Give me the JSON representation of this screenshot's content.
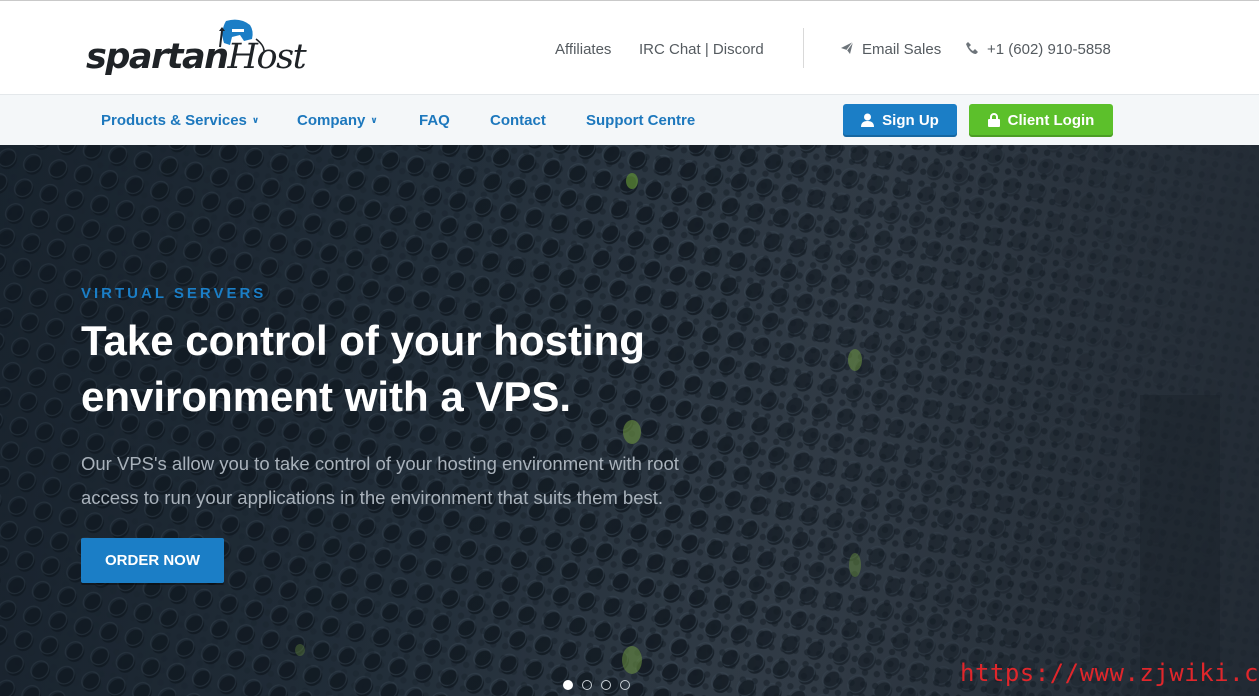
{
  "brand": {
    "logo_text_main": "spartan",
    "logo_text_sub": "Host"
  },
  "top_links": [
    {
      "label": "Affiliates"
    },
    {
      "label": "IRC Chat | Discord"
    }
  ],
  "contact": {
    "email_label": "Email Sales",
    "phone_label": "+1 (602) 910-5858"
  },
  "nav": {
    "items": [
      {
        "label": "Products & Services",
        "has_dropdown": true
      },
      {
        "label": "Company",
        "has_dropdown": true
      },
      {
        "label": "FAQ",
        "has_dropdown": false
      },
      {
        "label": "Contact",
        "has_dropdown": false
      },
      {
        "label": "Support Centre",
        "has_dropdown": false
      }
    ],
    "signup_label": "Sign Up",
    "login_label": "Client Login"
  },
  "hero": {
    "eyebrow": "VIRTUAL SERVERS",
    "headline_line1": "Take control of your hosting",
    "headline_line2": "environment with a VPS.",
    "subtext_line1": "Our VPS's allow you to take control of your hosting environment with root",
    "subtext_line2": "access to run your applications in the environment that suits them best.",
    "cta_label": "ORDER NOW",
    "slides_total": 4,
    "active_slide": 1
  },
  "watermark": "https://www.zjwiki.com",
  "colors": {
    "primary_blue": "#1b7ec6",
    "login_green": "#5cc02b",
    "nav_bg": "#f4f7f9",
    "hero_dark": "#2b3844"
  },
  "icons": [
    "paper-plane-icon",
    "phone-icon",
    "user-icon",
    "lock-icon",
    "chevron-down-icon"
  ]
}
